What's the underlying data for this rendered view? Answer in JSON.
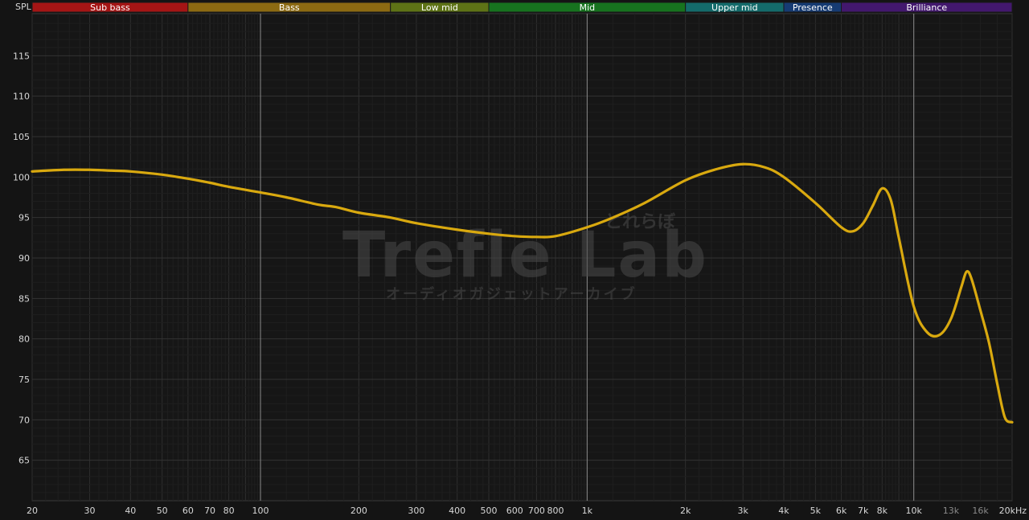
{
  "chart_data": {
    "type": "line",
    "ylabel": "SPL",
    "xscale": "log",
    "xlim": [
      20,
      20000
    ],
    "ylim": [
      60,
      120
    ],
    "grid": true,
    "bands": [
      {
        "name": "Sub bass",
        "from": 20,
        "to": 60,
        "color": "#a51515"
      },
      {
        "name": "Bass",
        "from": 60,
        "to": 250,
        "color": "#8c6a12"
      },
      {
        "name": "Low mid",
        "from": 250,
        "to": 500,
        "color": "#5e7316"
      },
      {
        "name": "Mid",
        "from": 500,
        "to": 2000,
        "color": "#17731f"
      },
      {
        "name": "Upper mid",
        "from": 2000,
        "to": 4000,
        "color": "#146b6b"
      },
      {
        "name": "Presence",
        "from": 4000,
        "to": 6000,
        "color": "#163b73"
      },
      {
        "name": "Brilliance",
        "from": 6000,
        "to": 20000,
        "color": "#43186e"
      }
    ],
    "x_ticks": [
      {
        "v": 20,
        "label": "20"
      },
      {
        "v": 30,
        "label": "30"
      },
      {
        "v": 40,
        "label": "40"
      },
      {
        "v": 50,
        "label": "50"
      },
      {
        "v": 60,
        "label": "60"
      },
      {
        "v": 70,
        "label": "70"
      },
      {
        "v": 80,
        "label": "80"
      },
      {
        "v": 100,
        "label": "100"
      },
      {
        "v": 200,
        "label": "200"
      },
      {
        "v": 300,
        "label": "300"
      },
      {
        "v": 400,
        "label": "400"
      },
      {
        "v": 500,
        "label": "500"
      },
      {
        "v": 600,
        "label": "600"
      },
      {
        "v": 700,
        "label": "700"
      },
      {
        "v": 800,
        "label": "800"
      },
      {
        "v": 1000,
        "label": "1k"
      },
      {
        "v": 2000,
        "label": "2k"
      },
      {
        "v": 3000,
        "label": "3k"
      },
      {
        "v": 4000,
        "label": "4k"
      },
      {
        "v": 5000,
        "label": "5k"
      },
      {
        "v": 6000,
        "label": "6k"
      },
      {
        "v": 7000,
        "label": "7k"
      },
      {
        "v": 8000,
        "label": "8k"
      },
      {
        "v": 10000,
        "label": "10k"
      },
      {
        "v": 13000,
        "label": "13k",
        "dim": true
      },
      {
        "v": 16000,
        "label": "16k",
        "dim": true
      },
      {
        "v": 20000,
        "label": "20kHz"
      }
    ],
    "y_ticks": [
      65,
      70,
      75,
      80,
      85,
      90,
      95,
      100,
      105,
      110,
      115
    ],
    "major_x": [
      100,
      1000,
      10000
    ],
    "series": [
      {
        "color": "#d9a90f",
        "x": [
          20,
          25,
          30,
          35,
          40,
          50,
          60,
          70,
          80,
          100,
          120,
          150,
          170,
          200,
          250,
          300,
          400,
          500,
          600,
          700,
          800,
          1000,
          1200,
          1500,
          2000,
          2500,
          3000,
          3500,
          4000,
          5000,
          6000,
          6500,
          7000,
          7500,
          8000,
          8500,
          9000,
          10000,
          11000,
          12000,
          13000,
          14000,
          14500,
          15000,
          16000,
          17000,
          18000,
          19000,
          20000
        ],
        "y": [
          100.7,
          100.9,
          100.9,
          100.8,
          100.7,
          100.3,
          99.8,
          99.3,
          98.8,
          98.1,
          97.5,
          96.6,
          96.3,
          95.6,
          95.0,
          94.3,
          93.5,
          93.0,
          92.7,
          92.6,
          92.7,
          93.8,
          95.0,
          96.8,
          99.6,
          101.0,
          101.6,
          101.2,
          100.0,
          96.8,
          93.8,
          93.3,
          94.3,
          96.5,
          98.6,
          97.2,
          92.5,
          84.0,
          80.8,
          80.5,
          82.5,
          86.5,
          88.3,
          87.5,
          83.5,
          79.5,
          74.5,
          70.3,
          69.7
        ]
      }
    ]
  },
  "watermark": {
    "main": "Trefle Lab",
    "jp_top": "とれらぼ",
    "sub": "オーディオガジェットアーカイブ"
  }
}
